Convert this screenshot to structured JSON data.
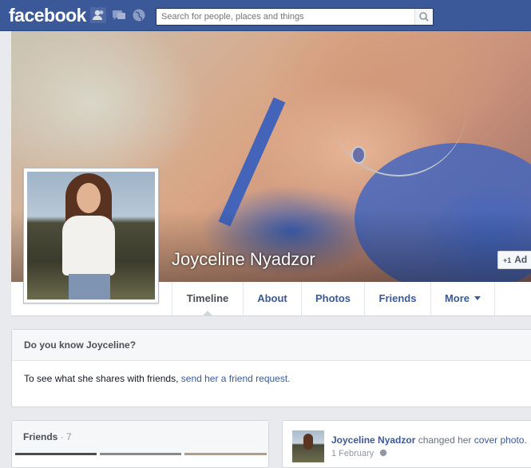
{
  "header": {
    "logo": "facebook",
    "search_placeholder": "Search for people, places and things"
  },
  "profile": {
    "name": "Joyceline Nyadzor",
    "add_friend_label": "Add Friend",
    "add_friend_visible": "Ad",
    "add_friend_plus": "+1"
  },
  "tabs": [
    {
      "label": "Timeline",
      "active": true
    },
    {
      "label": "About"
    },
    {
      "label": "Photos"
    },
    {
      "label": "Friends"
    },
    {
      "label": "More"
    }
  ],
  "know_card": {
    "title": "Do you know Joyceline?",
    "text": "To see what she shares with friends, ",
    "link": "send her a friend request."
  },
  "friends_box": {
    "title": "Friends",
    "count": "· 7"
  },
  "story": {
    "actor": "Joyceline Nyadzor",
    "action": " changed her ",
    "object": "cover photo.",
    "date": "1 February"
  }
}
